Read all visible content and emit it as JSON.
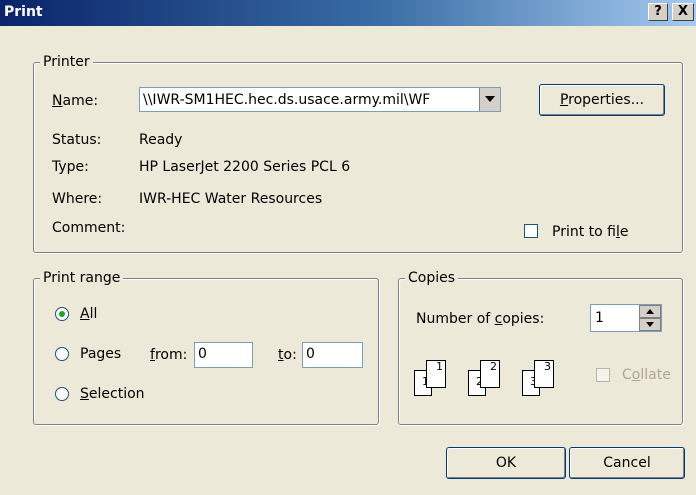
{
  "window": {
    "title": "Print",
    "help_label": "?",
    "close_label": "X"
  },
  "printer": {
    "legend": "Printer",
    "name_label": "Name:",
    "name_value": "\\\\IWR-SM1HEC.hec.ds.usace.army.mil\\WF",
    "properties_label": "Properties...",
    "status_label": "Status:",
    "status_value": "Ready",
    "type_label": "Type:",
    "type_value": "HP LaserJet 2200 Series PCL 6",
    "where_label": "Where:",
    "where_value": "IWR-HEC Water Resources",
    "comment_label": "Comment:",
    "print_to_file_label": "Print to file",
    "print_to_file_checked": false
  },
  "print_range": {
    "legend": "Print range",
    "all_label": "All",
    "pages_label": "Pages",
    "from_label": "from:",
    "from_value": "0",
    "to_label": "to:",
    "to_value": "0",
    "selection_label": "Selection",
    "selected": "All"
  },
  "copies": {
    "legend": "Copies",
    "number_label": "Number of copies:",
    "number_value": "1",
    "collate_label": "Collate",
    "collate_checked": false,
    "collate_enabled": false,
    "page_icons": [
      "1",
      "1",
      "2",
      "2",
      "3",
      "3"
    ]
  },
  "footer": {
    "ok_label": "OK",
    "cancel_label": "Cancel"
  },
  "colors": {
    "title_start": "#0A246A",
    "title_end": "#A6CAF0",
    "dialog_bg": "#ECE9D8",
    "radio_dot": "#21A121"
  }
}
